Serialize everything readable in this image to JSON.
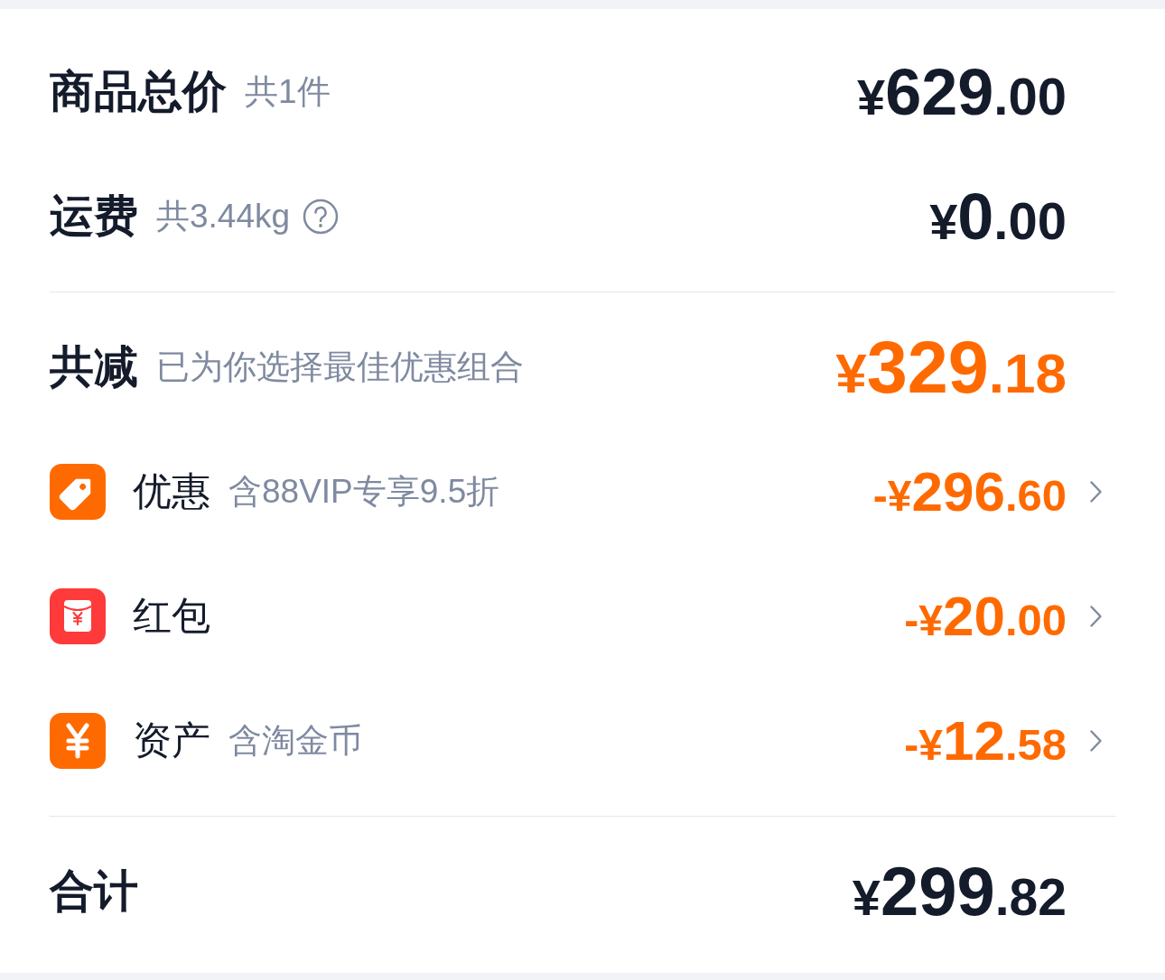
{
  "charges": [
    {
      "label": "商品总价",
      "note": "共1件",
      "help": false,
      "price": {
        "prefix": "¥",
        "whole": "629",
        "fraction": ".00"
      }
    },
    {
      "label": "运费",
      "note": "共3.44kg",
      "help": true,
      "price": {
        "prefix": "¥",
        "whole": "0",
        "fraction": ".00"
      }
    }
  ],
  "discount": {
    "label": "共减",
    "note": "已为你选择最佳优惠组合",
    "price": {
      "prefix": "¥",
      "whole": "329",
      "fraction": ".18"
    },
    "rows": [
      {
        "kind": "tag",
        "label": "优惠",
        "note": "含88VIP专享9.5折",
        "price": {
          "prefix": "-¥",
          "whole": "296",
          "fraction": ".60"
        }
      },
      {
        "kind": "red-packet",
        "label": "红包",
        "price": {
          "prefix": "-¥",
          "whole": "20",
          "fraction": ".00"
        }
      },
      {
        "kind": "coin",
        "label": "资产",
        "note": "含淘金币",
        "price": {
          "prefix": "-¥",
          "whole": "12",
          "fraction": ".58"
        }
      }
    ]
  },
  "total": {
    "label": "合计",
    "price": {
      "prefix": "¥",
      "whole": "299",
      "fraction": ".82"
    }
  }
}
